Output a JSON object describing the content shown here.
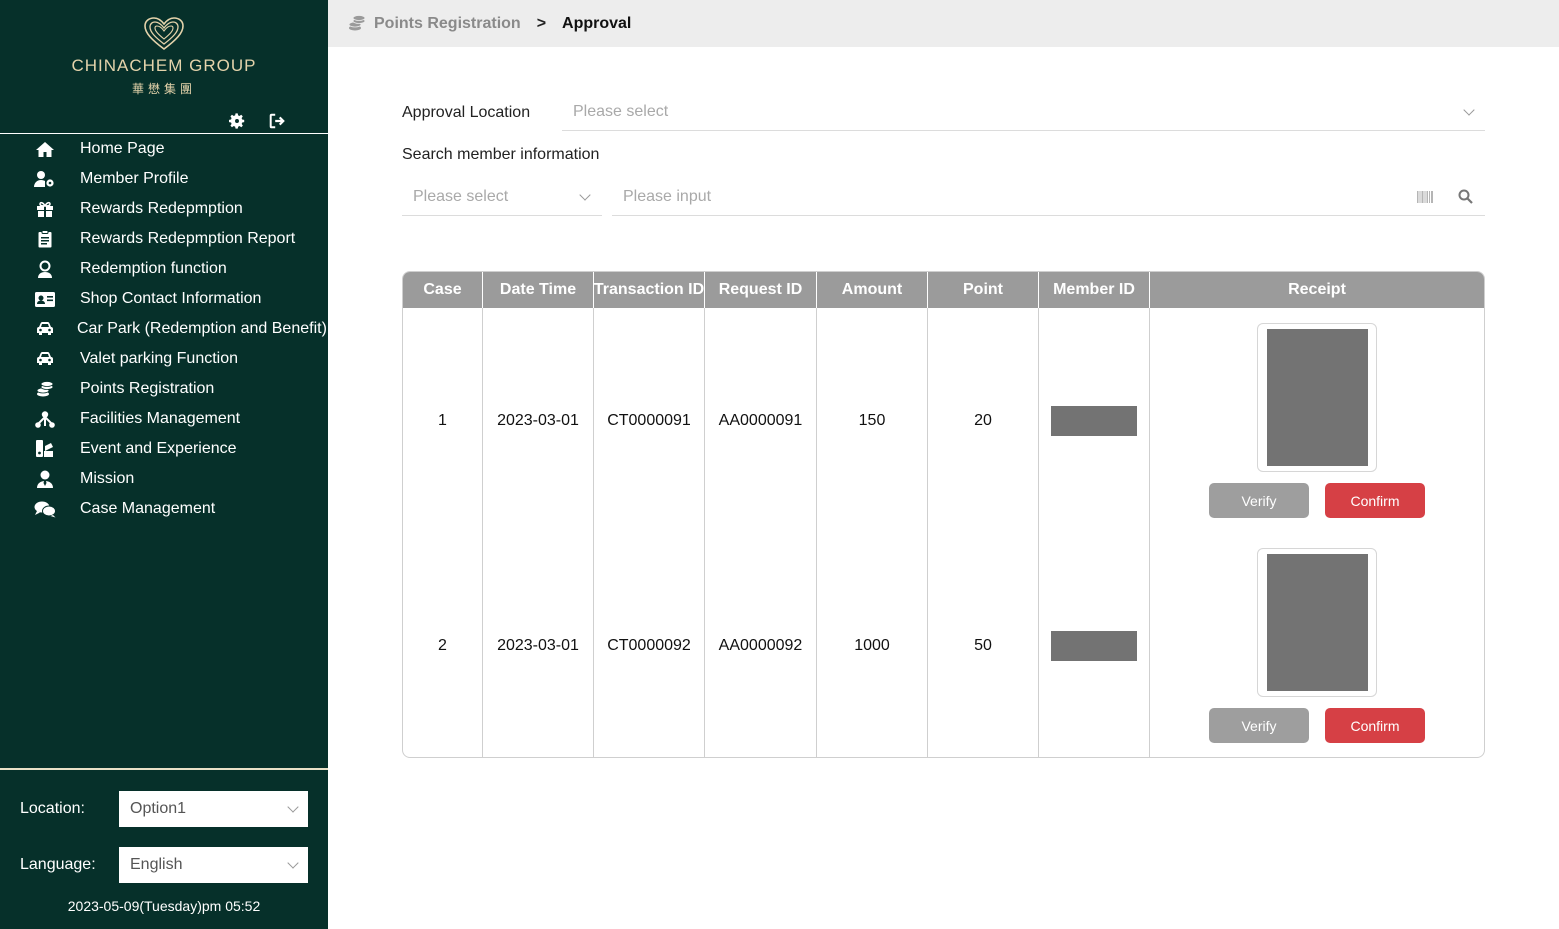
{
  "brand": {
    "name_en": "CHINACHEM GROUP",
    "name_zh": "華懋集團",
    "accent": "#e4d3ab"
  },
  "sidebar": {
    "bg_color": "#06302a",
    "top_icons": [
      "gear-icon",
      "sign-out-icon"
    ],
    "items": [
      {
        "label": "Home Page",
        "icon": "home-icon"
      },
      {
        "label": "Member Profile",
        "icon": "user-cog-icon"
      },
      {
        "label": "Rewards Redepmption",
        "icon": "gift-icon"
      },
      {
        "label": "Rewards Redepmption Report",
        "icon": "clipboard-icon"
      },
      {
        "label": "Redemption function",
        "icon": "user-badge-icon"
      },
      {
        "label": "Shop Contact Information",
        "icon": "id-card-icon"
      },
      {
        "label": "Car Park (Redemption and Benefit)",
        "icon": "car-icon"
      },
      {
        "label": "Valet parking Function",
        "icon": "car-icon"
      },
      {
        "label": "Points Registration",
        "icon": "coins-icon"
      },
      {
        "label": "Facilities Management",
        "icon": "sitemap-icon"
      },
      {
        "label": "Event and Experience",
        "icon": "event-icon"
      },
      {
        "label": "Mission",
        "icon": "user-tie-icon"
      },
      {
        "label": "Case Management",
        "icon": "comments-icon"
      }
    ],
    "location_label": "Location:",
    "location_value": "Option1",
    "language_label": "Language:",
    "language_value": "English",
    "datetime": "2023-05-09(Tuesday)pm 05:52"
  },
  "header": {
    "crumb_parent": "Points Registration",
    "crumb_separator": ">",
    "crumb_current": "Approval"
  },
  "form": {
    "approval_location_label": "Approval Location",
    "approval_location_placeholder": "Please select",
    "search_label": "Search member information",
    "search_type_placeholder": "Please select",
    "search_input_placeholder": "Please input"
  },
  "table": {
    "headers": [
      "Case",
      "Date Time",
      "Transaction ID",
      "Request ID",
      "Amount",
      "Point",
      "Member ID",
      "Receipt"
    ],
    "header_bg": "#9b9b9b",
    "rows": [
      {
        "case": "1",
        "datetime": "2023-03-01",
        "transaction_id": "CT0000091",
        "request_id": "AA0000091",
        "amount": "150",
        "point": "20"
      },
      {
        "case": "2",
        "datetime": "2023-03-01",
        "transaction_id": "CT0000092",
        "request_id": "AA0000092",
        "amount": "1000",
        "point": "50"
      }
    ],
    "verify_label": "Verify",
    "confirm_label": "Confirm",
    "confirm_color": "#d64045",
    "verify_color": "#9e9e9e"
  }
}
